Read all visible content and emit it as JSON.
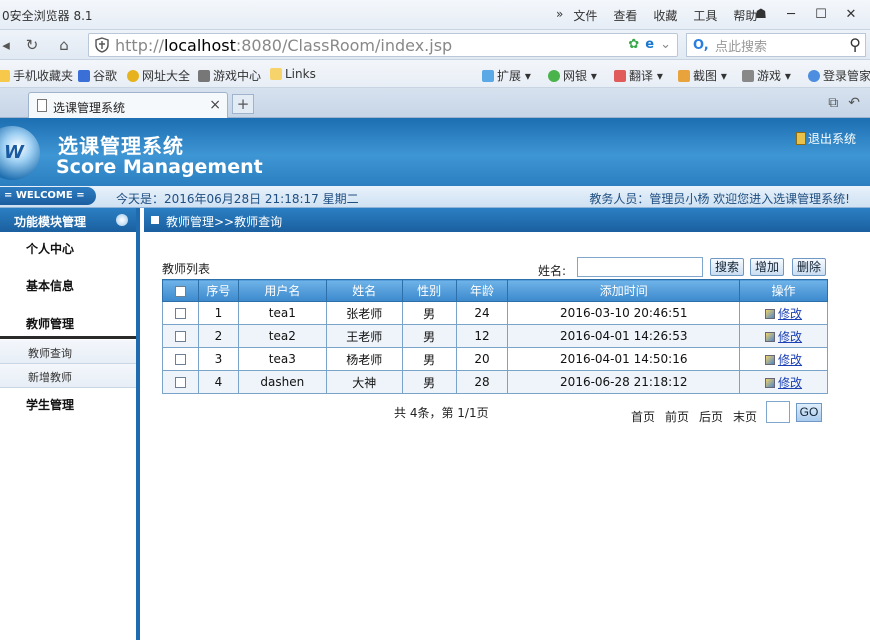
{
  "browser": {
    "title": "0安全浏览器 8.1",
    "menu": [
      "文件",
      "查看",
      "收藏",
      "工具",
      "帮助"
    ],
    "url_prefix": "http://",
    "url_host": "localhost",
    "url_rest": ":8080/ClassRoom/index.jsp",
    "search_placeholder": "点此搜索",
    "favorites": [
      "手机收藏夹",
      "谷歌",
      "网址大全",
      "游戏中心",
      "Links"
    ],
    "tools": [
      "扩展",
      "网银",
      "翻译",
      "截图",
      "游戏",
      "登录管家"
    ],
    "tab_title": "选课管理系统"
  },
  "app": {
    "title_cn": "选课管理系统",
    "title_en": "Score Management",
    "logout": "退出系统",
    "welcome_tag": "= WELCOME =",
    "today": "今天是：2016年06月28日    21:18:17   星期二",
    "user_info": "教务人员：管理员小杨    欢迎您进入选课管理系统!"
  },
  "sidebar": {
    "header": "功能模块管理",
    "items": [
      "个人中心",
      "基本信息",
      "教师管理",
      "学生管理"
    ],
    "subitems": [
      "教师查询",
      "新增教师"
    ]
  },
  "main": {
    "breadcrumb": "教师管理>>教师查询",
    "list_label": "教师列表",
    "name_label": "姓名:",
    "name_value": "",
    "buttons": {
      "search": "搜索",
      "add": "增加",
      "delete": "删除"
    },
    "columns": [
      "序号",
      "用户名",
      "姓名",
      "性别",
      "年龄",
      "添加时间",
      "操作"
    ],
    "rows": [
      {
        "no": "1",
        "username": "tea1",
        "name": "张老师",
        "gender": "男",
        "age": "24",
        "added": "2016-03-10 20:46:51",
        "action": "修改"
      },
      {
        "no": "2",
        "username": "tea2",
        "name": "王老师",
        "gender": "男",
        "age": "12",
        "added": "2016-04-01 14:26:53",
        "action": "修改"
      },
      {
        "no": "3",
        "username": "tea3",
        "name": "杨老师",
        "gender": "男",
        "age": "20",
        "added": "2016-04-01 14:50:16",
        "action": "修改"
      },
      {
        "no": "4",
        "username": "dashen",
        "name": "大神",
        "gender": "男",
        "age": "28",
        "added": "2016-06-28 21:18:12",
        "action": "修改"
      }
    ],
    "pagination": {
      "info": "共 4条，第 1/1页",
      "first": "首页",
      "prev": "前页",
      "next": "后页",
      "last": "末页",
      "go": "GO"
    }
  }
}
